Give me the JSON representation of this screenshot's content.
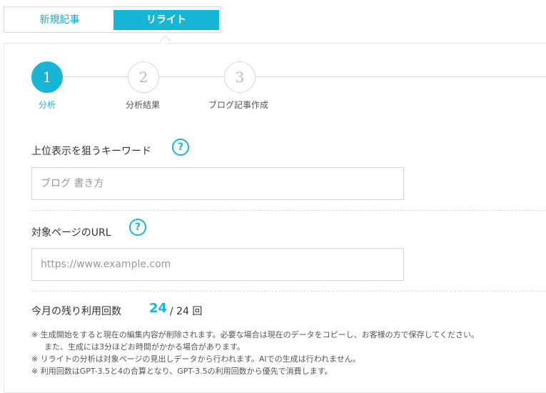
{
  "tabs": {
    "new_article": "新規記事",
    "rewrite": "リライト"
  },
  "steps": [
    {
      "number": "1",
      "label": "分析"
    },
    {
      "number": "2",
      "label": "分析結果"
    },
    {
      "number": "3",
      "label": "ブログ記事作成"
    }
  ],
  "keyword": {
    "label": "上位表示を狙うキーワード",
    "help": "?",
    "placeholder": "ブログ 書き方"
  },
  "url": {
    "label": "対象ページのURL",
    "help": "?",
    "placeholder": "https://www.example.com"
  },
  "usage": {
    "label": "今月の残り利用回数",
    "remaining": "24",
    "rest": "/ 24 回"
  },
  "notes": [
    "※ 生成開始をすると現在の編集内容が削除されます。必要な場合は現在のデータをコピーし、お客様の方で保存してください。",
    "また、生成には3分ほどお時間がかかる場合があります。",
    "※ リライトの分析は対象ページの見出しデータから行われます。AIでの生成は行われません。",
    "※ 利用回数はGPT-3.5と4の合算となり、GPT-3.5の利用回数から優先で消費します。"
  ],
  "colors": {
    "accent": "#18b6d6",
    "inactive": "#d6d6d6"
  }
}
